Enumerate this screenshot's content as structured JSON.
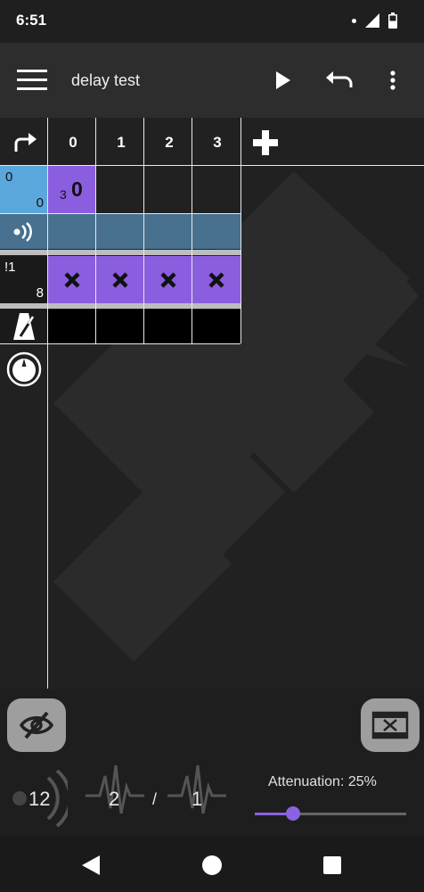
{
  "status": {
    "time": "6:51"
  },
  "toolbar": {
    "title": "delay test"
  },
  "grid": {
    "columns": [
      "0",
      "1",
      "2",
      "3"
    ],
    "channel_row": {
      "top_value": "0",
      "bottom_value": "0"
    },
    "first_cell": {
      "small": "3",
      "big": "0"
    },
    "drum_row": {
      "top_value": "!1",
      "bottom_value": "8"
    }
  },
  "bottom": {
    "left_number": "12",
    "mid_number": "2",
    "slash": "/",
    "right_number": "1",
    "attenuation_label": "Attenuation: 25%",
    "attenuation_value": 0.25
  },
  "colors": {
    "accent": "#8a63e0",
    "channel_blue": "#5aa7db",
    "fx_row": "#47718f",
    "purple_cell": "#8b5ee0"
  }
}
